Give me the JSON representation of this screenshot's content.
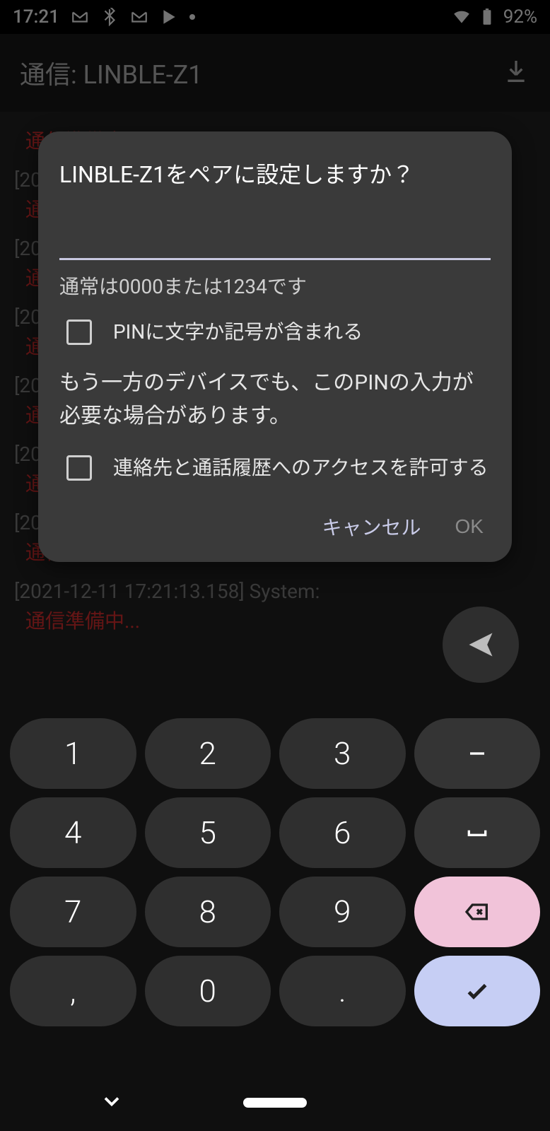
{
  "status": {
    "time": "17:21",
    "battery": "92%"
  },
  "app": {
    "title": "通信: LINBLE-Z1"
  },
  "logs": [
    {
      "meta": "通信準備中...",
      "status": ""
    },
    {
      "meta": "[20",
      "status": "通"
    },
    {
      "meta": "[20",
      "status": "通"
    },
    {
      "meta": "[20",
      "status": "通"
    },
    {
      "meta": "[20",
      "status": "通"
    },
    {
      "meta": "[20",
      "status": "通"
    },
    {
      "meta": "[20",
      "status": "通信"
    },
    {
      "meta": "[2021-12-11 17:21:13.158]  System:",
      "status": "通信準備中..."
    }
  ],
  "dialog": {
    "title": "LINBLE-Z1をペアに設定しますか？",
    "hint": "通常は0000または1234です",
    "checkbox1": "PINに文字か記号が含まれる",
    "info": "もう一方のデバイスでも、このPINの入力が必要な場合があります。",
    "checkbox2": "連絡先と通話履歴へのアクセスを許可する",
    "cancel": "キャンセル",
    "ok": "OK"
  },
  "keyboard": {
    "rows": [
      [
        "1",
        "2",
        "3",
        "-"
      ],
      [
        "4",
        "5",
        "6",
        "␣"
      ],
      [
        "7",
        "8",
        "9",
        "⌫"
      ],
      [
        ",",
        "0",
        ".",
        "✓"
      ]
    ]
  }
}
